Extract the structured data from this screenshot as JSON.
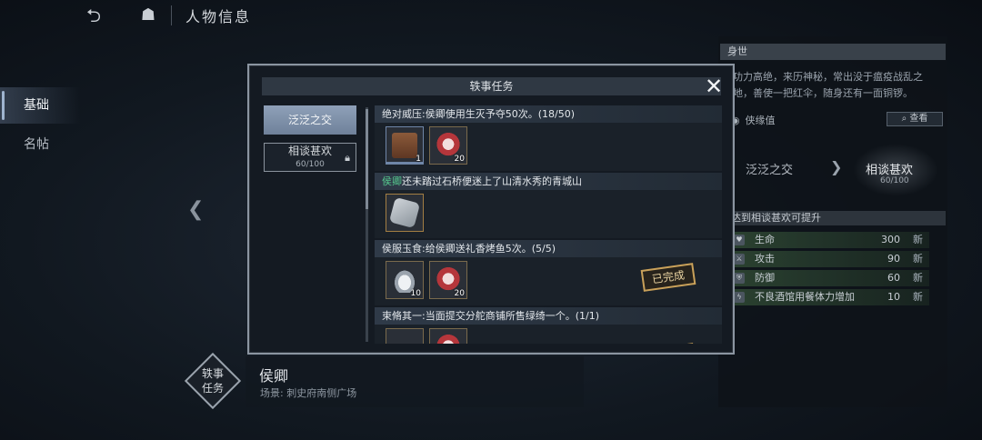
{
  "topbar": {
    "back_icon": "back-arrow-icon",
    "home_icon": "home-icon",
    "title": "人物信息"
  },
  "side_nav": {
    "items": [
      {
        "label": "基础",
        "active": true
      },
      {
        "label": "名帖",
        "active": false
      }
    ]
  },
  "character": {
    "badge_line1": "轶事",
    "badge_line2": "任务",
    "name": "侯卿",
    "scene": "场景: 刺史府南侧广场"
  },
  "right_panel": {
    "section_title": "身世",
    "description": "功力高绝，来历神秘，常出没于瘟疫战乱之地，善使一把红伞，随身还有一面铜锣。",
    "bond_label": "侠缘值",
    "view_button": "查看",
    "stage_from": "泛泛之交",
    "stage_to": "相谈甚欢",
    "stage_to_value": "60/100",
    "upgrade_title": "达到相谈甚欢可提升",
    "stats": [
      {
        "icon": "heart-icon",
        "name": "生命",
        "value": "300",
        "tag": "新"
      },
      {
        "icon": "attack-icon",
        "name": "攻击",
        "value": "90",
        "tag": "新"
      },
      {
        "icon": "shield-icon",
        "name": "防御",
        "value": "60",
        "tag": "新"
      },
      {
        "icon": "lightning-icon",
        "name": "不良酒馆用餐体力增加",
        "value": "10",
        "tag": "新"
      }
    ]
  },
  "modal": {
    "title": "轶事任务",
    "close_icon": "close-icon",
    "tabs": [
      {
        "label": "泛泛之交",
        "selected": true
      },
      {
        "label": "相谈甚欢",
        "progress": "60/100",
        "locked": true
      }
    ],
    "tasks": [
      {
        "title": "绝对威压:侯卿使用生灭予夺50次。(18/50)",
        "items": [
          {
            "icon": "treasure-chest-icon",
            "count": "1"
          },
          {
            "icon": "red-tassel-icon",
            "count": "20"
          }
        ],
        "completed": false
      },
      {
        "highlight": "侯卿",
        "title": "还未踏过石桥便迷上了山清水秀的青城山",
        "items": [
          {
            "icon": "scroll-icon",
            "count": ""
          }
        ],
        "completed": false
      },
      {
        "title": "侯服玉食:给侯卿送礼香烤鱼5次。(5/5)",
        "items": [
          {
            "icon": "silver-ingot-icon",
            "count": "10"
          },
          {
            "icon": "red-tassel-icon",
            "count": "20"
          }
        ],
        "completed": true,
        "stamp": "已完成"
      },
      {
        "title": "束脩其一:当面提交分舵商铺所售绿绮一个。(1/1)",
        "items": [],
        "completed": true
      }
    ]
  }
}
